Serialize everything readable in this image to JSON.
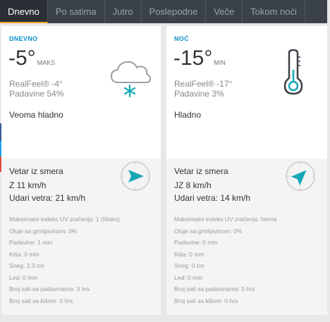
{
  "tabs": [
    "Dnevno",
    "Po satima",
    "Jutro",
    "Poslepodne",
    "Veče",
    "Tokom noći"
  ],
  "day": {
    "label": "DNEVNO",
    "temp": "-5°",
    "temp_unit": "MAKS",
    "realfeel": "RealFeel® -4°",
    "precip": "Padavine 54%",
    "phrase": "Veoma hladno",
    "icon": "cloud-snow-icon",
    "wind_title": "Vetar iz smera",
    "wind_dir": "Z 11 km/h",
    "gust": "Udari vetra: 21 km/h",
    "details": [
      "Maksimalni indeks UV zračenja: 1 (Nisko)",
      "Oluje sa grmljavinom: 0%",
      "Padavine: 1 mm",
      "Kiša: 0 mm",
      "Sneg: 2.3 cm",
      "Led: 0 mm",
      "Broj sati sa padavinama: 3 hrs",
      "Broj sati sa kišom: 0 hrs"
    ]
  },
  "night": {
    "label": "NOĆ",
    "temp": "-15°",
    "temp_unit": "MIN",
    "realfeel": "RealFeel® -17°",
    "precip": "Padavine 3%",
    "phrase": "Hladno",
    "icon": "thermometer-icon",
    "wind_title": "Vetar iz smera",
    "wind_dir": "JZ 8 km/h",
    "gust": "Udari vetra: 14 km/h",
    "details": [
      "Maksimalni indeks UV zračenja: Nema",
      "Oluje sa grmljavinom: 0%",
      "Padavine: 0 mm",
      "Kiša: 0 mm",
      "Sneg: 0 cm",
      "Led: 0 mm",
      "Broj sati sa padavinama: 0 hrs",
      "Broj sati sa kišom: 0 hrs"
    ]
  },
  "colors": {
    "accent": "#0a8fcc",
    "active_tab_underline": "#f2a531",
    "icon_teal": "#17a8b8"
  }
}
